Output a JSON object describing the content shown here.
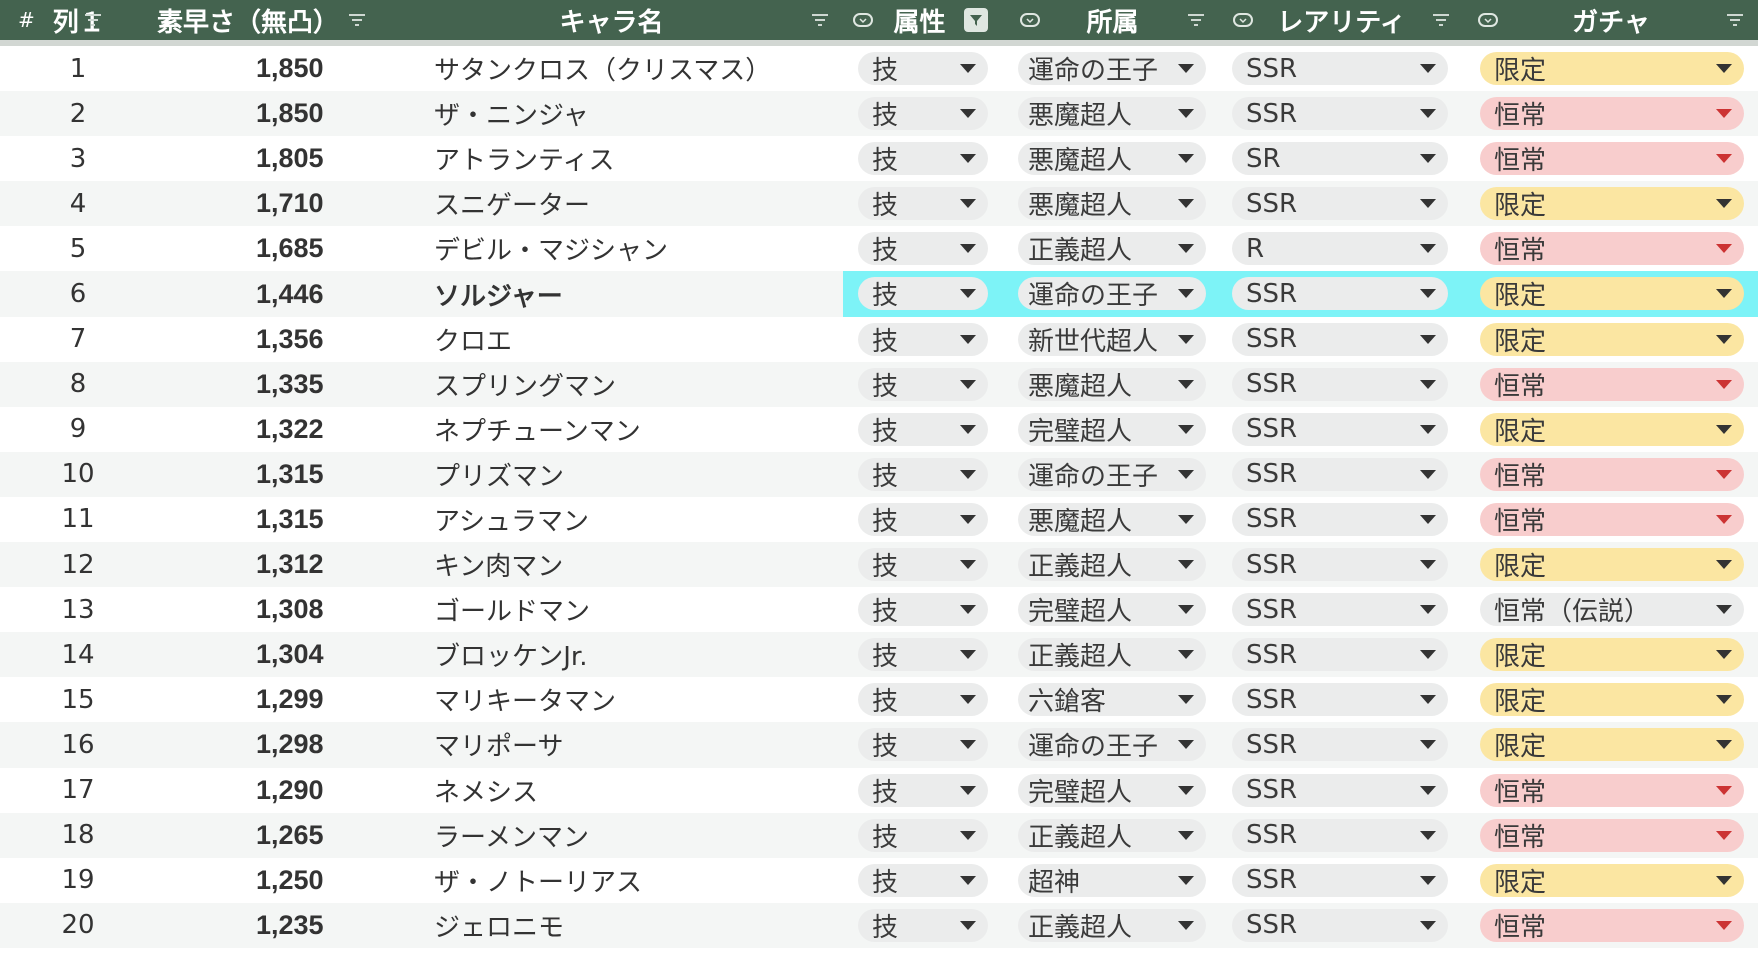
{
  "header": {
    "hash": "#",
    "col1": "列１",
    "speed": "素早さ（無凸）",
    "name": "キャラ名",
    "attr": "属性",
    "affiliation": "所属",
    "rarity": "レアリティ",
    "gacha": "ガチャ"
  },
  "colors": {
    "header_bg": "#44634f",
    "selected_row": "#7df3f7",
    "limited_chip": "#fbe6a2",
    "standard_chip": "#f8cdcd",
    "neutral_chip": "#ebecec"
  },
  "rows": [
    {
      "rank": "1",
      "speed": "1,850",
      "name": "サタンクロス（クリスマス）",
      "attr": "技",
      "affiliation": "運命の王子",
      "rarity": "SSR",
      "gacha": "限定",
      "gacha_type": "limited"
    },
    {
      "rank": "2",
      "speed": "1,850",
      "name": "ザ・ニンジャ",
      "attr": "技",
      "affiliation": "悪魔超人",
      "rarity": "SSR",
      "gacha": "恒常",
      "gacha_type": "standard"
    },
    {
      "rank": "3",
      "speed": "1,805",
      "name": "アトランティス",
      "attr": "技",
      "affiliation": "悪魔超人",
      "rarity": "SR",
      "gacha": "恒常",
      "gacha_type": "standard"
    },
    {
      "rank": "4",
      "speed": "1,710",
      "name": "スニゲーター",
      "attr": "技",
      "affiliation": "悪魔超人",
      "rarity": "SSR",
      "gacha": "限定",
      "gacha_type": "limited"
    },
    {
      "rank": "5",
      "speed": "1,685",
      "name": "デビル・マジシャン",
      "attr": "技",
      "affiliation": "正義超人",
      "rarity": "R",
      "gacha": "恒常",
      "gacha_type": "standard"
    },
    {
      "rank": "6",
      "speed": "1,446",
      "name": "ソルジャー",
      "attr": "技",
      "affiliation": "運命の王子",
      "rarity": "SSR",
      "gacha": "限定",
      "gacha_type": "limited",
      "selected": true
    },
    {
      "rank": "7",
      "speed": "1,356",
      "name": "クロエ",
      "attr": "技",
      "affiliation": "新世代超人",
      "rarity": "SSR",
      "gacha": "限定",
      "gacha_type": "limited"
    },
    {
      "rank": "8",
      "speed": "1,335",
      "name": "スプリングマン",
      "attr": "技",
      "affiliation": "悪魔超人",
      "rarity": "SSR",
      "gacha": "恒常",
      "gacha_type": "standard"
    },
    {
      "rank": "9",
      "speed": "1,322",
      "name": "ネプチューンマン",
      "attr": "技",
      "affiliation": "完璧超人",
      "rarity": "SSR",
      "gacha": "限定",
      "gacha_type": "limited"
    },
    {
      "rank": "10",
      "speed": "1,315",
      "name": "プリズマン",
      "attr": "技",
      "affiliation": "運命の王子",
      "rarity": "SSR",
      "gacha": "恒常",
      "gacha_type": "standard"
    },
    {
      "rank": "11",
      "speed": "1,315",
      "name": "アシュラマン",
      "attr": "技",
      "affiliation": "悪魔超人",
      "rarity": "SSR",
      "gacha": "恒常",
      "gacha_type": "standard"
    },
    {
      "rank": "12",
      "speed": "1,312",
      "name": "キン肉マン",
      "attr": "技",
      "affiliation": "正義超人",
      "rarity": "SSR",
      "gacha": "限定",
      "gacha_type": "limited"
    },
    {
      "rank": "13",
      "speed": "1,308",
      "name": "ゴールドマン",
      "attr": "技",
      "affiliation": "完璧超人",
      "rarity": "SSR",
      "gacha": "恒常（伝説）",
      "gacha_type": "legend"
    },
    {
      "rank": "14",
      "speed": "1,304",
      "name": "ブロッケンJr.",
      "attr": "技",
      "affiliation": "正義超人",
      "rarity": "SSR",
      "gacha": "限定",
      "gacha_type": "limited"
    },
    {
      "rank": "15",
      "speed": "1,299",
      "name": "マリキータマン",
      "attr": "技",
      "affiliation": "六鎗客",
      "rarity": "SSR",
      "gacha": "限定",
      "gacha_type": "limited"
    },
    {
      "rank": "16",
      "speed": "1,298",
      "name": "マリポーサ",
      "attr": "技",
      "affiliation": "運命の王子",
      "rarity": "SSR",
      "gacha": "限定",
      "gacha_type": "limited"
    },
    {
      "rank": "17",
      "speed": "1,290",
      "name": "ネメシス",
      "attr": "技",
      "affiliation": "完璧超人",
      "rarity": "SSR",
      "gacha": "恒常",
      "gacha_type": "standard"
    },
    {
      "rank": "18",
      "speed": "1,265",
      "name": "ラーメンマン",
      "attr": "技",
      "affiliation": "正義超人",
      "rarity": "SSR",
      "gacha": "恒常",
      "gacha_type": "standard"
    },
    {
      "rank": "19",
      "speed": "1,250",
      "name": "ザ・ノトーリアス",
      "attr": "技",
      "affiliation": "超神",
      "rarity": "SSR",
      "gacha": "限定",
      "gacha_type": "limited"
    },
    {
      "rank": "20",
      "speed": "1,235",
      "name": "ジェロニモ",
      "attr": "技",
      "affiliation": "正義超人",
      "rarity": "SSR",
      "gacha": "恒常",
      "gacha_type": "standard"
    }
  ]
}
